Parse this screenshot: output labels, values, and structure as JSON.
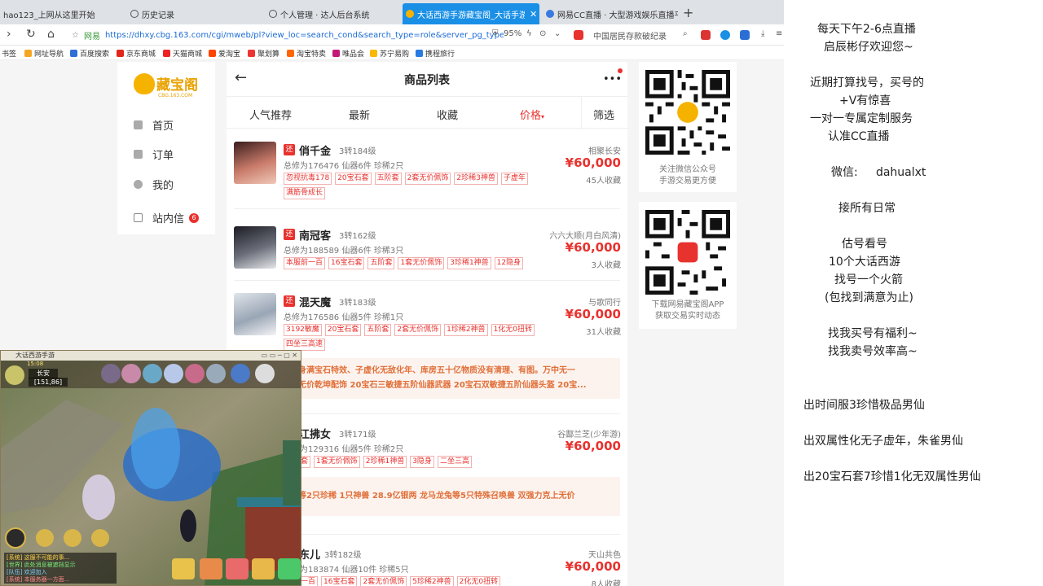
{
  "browser": {
    "tabs": [
      {
        "title": "hao123_上网从这里开始"
      },
      {
        "title": "历史记录"
      },
      {
        "title": "个人管理 · 达人后台系统"
      },
      {
        "title": "大话西游手游藏宝阁_大话手游交易平台"
      },
      {
        "title": "网易CC直播 · 大型游戏娱乐直播平台"
      }
    ],
    "address": {
      "site_label": "网易",
      "url": "https://dhxy.cbg.163.com/cgi/mweb/pl?view_loc=search_cond&search_type=role&server_pg_type",
      "zoom": "95%",
      "search_hint": "中国居民存款破纪录"
    },
    "bookmarks": [
      "书签",
      "网址导航",
      "百度搜索",
      "京东商城",
      "天猫商城",
      "爱淘宝",
      "聚划算",
      "淘宝特卖",
      "唯品会",
      "苏宁易购",
      "携程旅行"
    ],
    "colors": {
      "active_tab": "#1a8fe6",
      "url": "#1a6bd6"
    }
  },
  "sidenav": {
    "logo_text": "藏宝阁",
    "logo_sub": "CBG.163.COM",
    "items": [
      {
        "label": "首页",
        "icon": "home-icon"
      },
      {
        "label": "订单",
        "icon": "order-icon"
      },
      {
        "label": "我的",
        "icon": "user-icon"
      },
      {
        "label": "站内信",
        "icon": "mail-icon",
        "badge": "6"
      }
    ]
  },
  "list": {
    "title": "商品列表",
    "sort": [
      "人气推荐",
      "最新",
      "收藏",
      "价格",
      "筛选"
    ],
    "active_sort": "价格",
    "items": [
      {
        "tag": "还",
        "name": "俏千金",
        "level": "3转184级",
        "server": "相聚长安",
        "stats": "总修为176476 仙器6件 珍稀2只",
        "price": "¥60,000",
        "fav": "45人收藏",
        "tags": [
          "忽视抗毒178",
          "20宝石套",
          "五阶套",
          "2套无价佩饰",
          "2珍稀3神兽",
          "子虚年",
          "满筋骨成长"
        ]
      },
      {
        "tag": "还",
        "name": "南冠客",
        "level": "3转162级",
        "server": "六六大顺(月白风清)",
        "stats": "总修为188589 仙器6件 珍稀3只",
        "price": "¥60,000",
        "fav": "3人收藏",
        "tags": [
          "本服前一百",
          "16宝石套",
          "五阶套",
          "1套无价佩饰",
          "3珍稀1神兽",
          "12隐身"
        ]
      },
      {
        "tag": "还",
        "name": "混天魔",
        "level": "3转183级",
        "server": "与歌同行",
        "stats": "总修为176586 仙器5件 珍稀1只",
        "price": "¥60,000",
        "fav": "31人收藏",
        "tags": [
          "3192敏魔",
          "20宝石套",
          "五阶套",
          "2套无价佩饰",
          "1珍稀2神兽",
          "1化无0扭转",
          "四坐三高速"
        ]
      },
      {
        "promo": "全身满宝石特效、子虚化无敌化年、库房五十亿物质没有清理、有图。万中无一\n三无价乾坤配饰 20宝石三敏捷五阶仙器武器 20宝石双敏捷五阶仙器头盔 20宝..."
      },
      {
        "name": "江拂女",
        "level": "3转171级",
        "server": "谷酃兰芝(少年游)",
        "stats": "总修为129316 仙器5件 珍稀2只",
        "price": "¥60,000",
        "fav": "",
        "tags": [
          "宝石套",
          "1套无价佩饰",
          "2珍稀1神兽",
          "3隐身",
          "二坐三高"
        ]
      },
      {
        "promo": "龙等2只珍稀 1只神兽 28.9亿银两 龙马龙兔等5只特殊召唤兽 双强力克上无价"
      },
      {
        "name": "东儿",
        "level": "3转182级",
        "server": "天山共色",
        "stats": "总修为183874 仙器10件 珍稀5只",
        "price": "¥60,000",
        "fav": "8人收藏",
        "tags": [
          "服前一百",
          "16宝石套",
          "2套无价佩饰",
          "5珍稀2神兽",
          "2化无0扭转"
        ]
      }
    ]
  },
  "qr": [
    {
      "caption": [
        "关注微信公众号",
        "手游交易更方便"
      ]
    },
    {
      "caption": [
        "下载网易藏宝阁APP",
        "获取交易实时动态"
      ]
    }
  ],
  "sidetext": {
    "lines": [
      "每天下午2-6点直播",
      "启辰彬仔欢迎您~",
      "近期打算找号，买号的",
      "+V有惊喜",
      "一对一专属定制服务",
      "认准CC直播",
      "微信:     dahualxt",
      "接所有日常",
      "估号看号",
      "10个大话西游",
      "找号一个火箭",
      "(包找到满意为止)",
      "找我买号有福利~",
      "找我卖号效率高~",
      "出时间服3珍惜极品男仙",
      "出双属性化无子虚年，朱雀男仙",
      "出20宝石套7珍惜1化无双属性男仙"
    ]
  },
  "game": {
    "title": "大话西游手游",
    "location": "长安",
    "coords": "[151,86]",
    "level_badge": "15:08",
    "chat": [
      "[系统] 这服不可能的事...",
      "[世界] 此处消息被遮挡显示",
      "[队伍] 欢迎加入",
      "[系统] 本服务器一方面..."
    ]
  }
}
